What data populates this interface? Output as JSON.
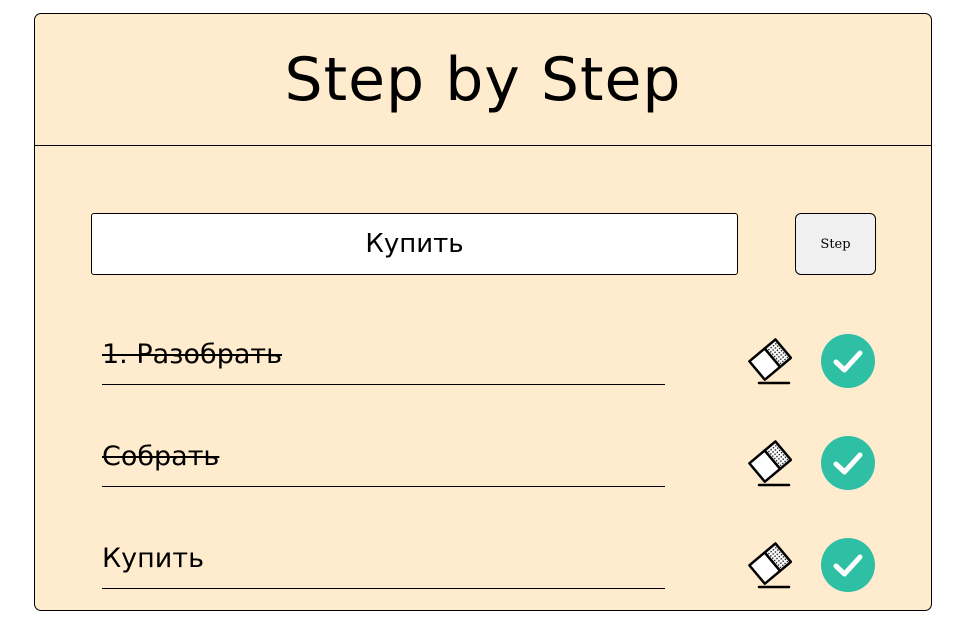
{
  "app": {
    "title": "Step by Step"
  },
  "form": {
    "input_value": "Купить",
    "button_label": "Step"
  },
  "tasks": [
    {
      "text": "1. Разобрать",
      "done": true
    },
    {
      "text": "Собрать",
      "done": true
    },
    {
      "text": "Купить",
      "done": false
    }
  ],
  "icons": {
    "delete": "eraser-icon",
    "complete": "check-circle-icon"
  },
  "colors": {
    "card_background": "#ffebcd",
    "check_circle": "#2ebfa5",
    "check_mark": "#ffffff"
  }
}
